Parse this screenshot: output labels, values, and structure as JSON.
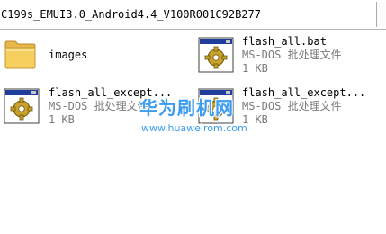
{
  "address_bar": {
    "path": "C199s_EMUI3.0_Android4.4_V100R001C92B277"
  },
  "files": [
    {
      "name": "images",
      "kind": "folder"
    },
    {
      "name": "flash_all.bat",
      "type": "MS-DOS 批处理文件",
      "size": "1 KB",
      "kind": "bat"
    },
    {
      "name": "flash_all_except...",
      "type": "MS-DOS 批处理文件",
      "size": "1 KB",
      "kind": "bat"
    },
    {
      "name": "flash_all_except...",
      "type": "MS-DOS 批处理文件",
      "size": "1 KB",
      "kind": "bat"
    }
  ],
  "watermark": {
    "brand": "华为刷机网",
    "url": "www.huaweirom.com",
    "color": "#3b9cf0"
  },
  "icons": {
    "folder": "folder-icon",
    "bat": "batch-file-gear-icon"
  }
}
